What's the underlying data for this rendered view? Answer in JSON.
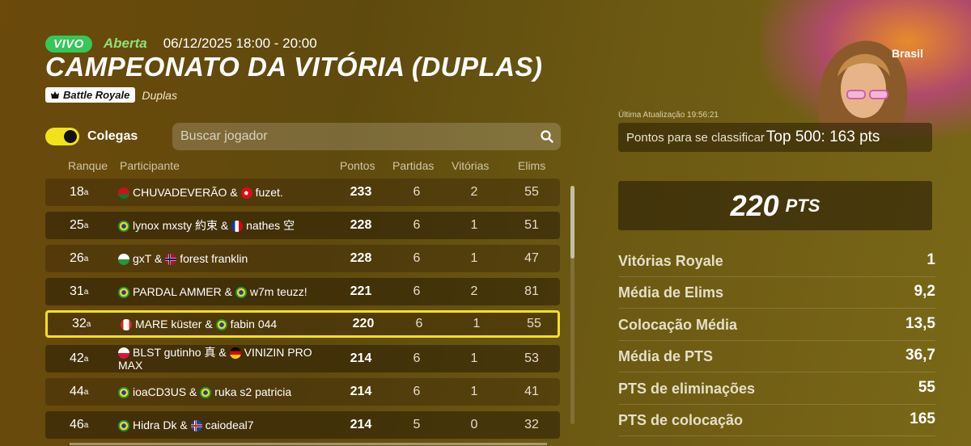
{
  "header": {
    "live_badge": "VIVO",
    "status": "Aberta",
    "datetime": "06/12/2025 18:00 - 20:00",
    "title": "CAMPEONATO DA VITÓRIA (DUPLAS)",
    "mode_badge": "Battle Royale",
    "mode_sub": "Duplas"
  },
  "filters": {
    "toggle_label": "Colegas",
    "toggle_on": true,
    "search_placeholder": "Buscar jogador"
  },
  "table": {
    "columns": [
      "Ranque",
      "Participante",
      "Pontos",
      "Partidas",
      "Vitórias",
      "Elims"
    ],
    "rows": [
      {
        "rank": "18",
        "p1": "CHUVADEVERÃO",
        "p2": "fuzet.",
        "f1": "BY",
        "f2": "TR",
        "points": "233",
        "matches": "6",
        "wins": "2",
        "elims": "55"
      },
      {
        "rank": "25",
        "p1": "lynox mxsty 約束",
        "p2": "nathes 空",
        "f1": "BR",
        "f2": "FR",
        "points": "228",
        "matches": "6",
        "wins": "1",
        "elims": "51"
      },
      {
        "rank": "26",
        "p1": "gxT",
        "p2": "forest franklin",
        "f1": "WALES",
        "f2": "NO",
        "points": "228",
        "matches": "6",
        "wins": "1",
        "elims": "47"
      },
      {
        "rank": "31",
        "p1": "PARDAL AMMER",
        "p2": "w7m teuzz!",
        "f1": "BR",
        "f2": "BR",
        "points": "221",
        "matches": "6",
        "wins": "2",
        "elims": "81"
      },
      {
        "rank": "32",
        "p1": "MARE küster",
        "p2": "fabin 044",
        "f1": "CA",
        "f2": "BR",
        "points": "220",
        "matches": "6",
        "wins": "1",
        "elims": "55",
        "highlight": true
      },
      {
        "rank": "42",
        "p1": "BLST gutinho 真",
        "p2": "VINIZIN PRO MAX",
        "f1": "PL",
        "f2": "DE",
        "points": "214",
        "matches": "6",
        "wins": "1",
        "elims": "53"
      },
      {
        "rank": "44",
        "p1": "ioaCD3US",
        "p2": "ruka s2 patricia",
        "f1": "BR",
        "f2": "BR",
        "points": "214",
        "matches": "6",
        "wins": "1",
        "elims": "41"
      },
      {
        "rank": "46",
        "p1": "Hidra Dk",
        "p2": "caiodeal7",
        "f1": "BR",
        "f2": "IS",
        "points": "214",
        "matches": "5",
        "wins": "0",
        "elims": "32"
      }
    ],
    "rank_suffix": "a"
  },
  "panel": {
    "region": "Brasil",
    "last_update": "Última Atualização 19:56:21",
    "qualify_label": "Pontos para se classificar",
    "qualify_value": "Top 500: 163 pts",
    "points_value": "220",
    "points_unit": "PTS",
    "stats": [
      {
        "label": "Vitórias Royale",
        "value": "1"
      },
      {
        "label": "Média de Elims",
        "value": "9,2"
      },
      {
        "label": "Colocação Média",
        "value": "13,5"
      },
      {
        "label": "Média de PTS",
        "value": "36,7"
      },
      {
        "label": "PTS de eliminações",
        "value": "55"
      },
      {
        "label": "PTS de colocação",
        "value": "165"
      }
    ]
  },
  "colors": {
    "live_green": "#34c759",
    "highlight_yellow": "#f2e21a",
    "toggle_yellow": "#f2e21a"
  }
}
